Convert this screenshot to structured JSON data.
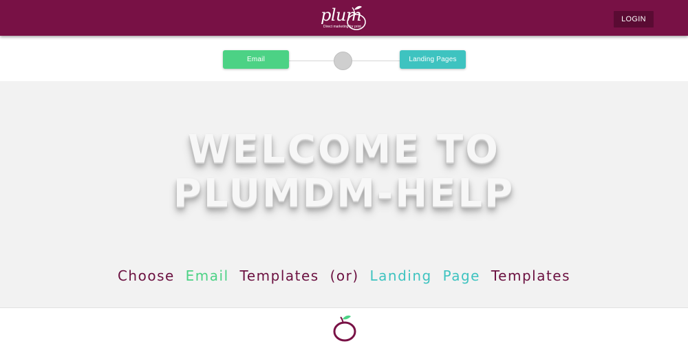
{
  "header": {
    "logo": {
      "wordmark": "plum",
      "tagline": "Direct marketing for print"
    },
    "login_label": "LOGIN",
    "background_color": "#781145"
  },
  "stepper": {
    "email_label": "Email",
    "landing_label": "Landing Pages",
    "email_color": "#4cd285",
    "landing_color": "#3ec3c0",
    "middle_step_color": "#cfcfcf"
  },
  "hero": {
    "welcome_line1": "WELCOME TO",
    "welcome_line2": "PLUMDM-HELP",
    "choose": {
      "word1": "Choose",
      "email": "Email",
      "word2": "Templates",
      "or": "(or)",
      "landing": "Landing",
      "page": "Page",
      "word3": "Templates"
    }
  },
  "footer": {
    "icon": "plum-fruit-icon"
  }
}
